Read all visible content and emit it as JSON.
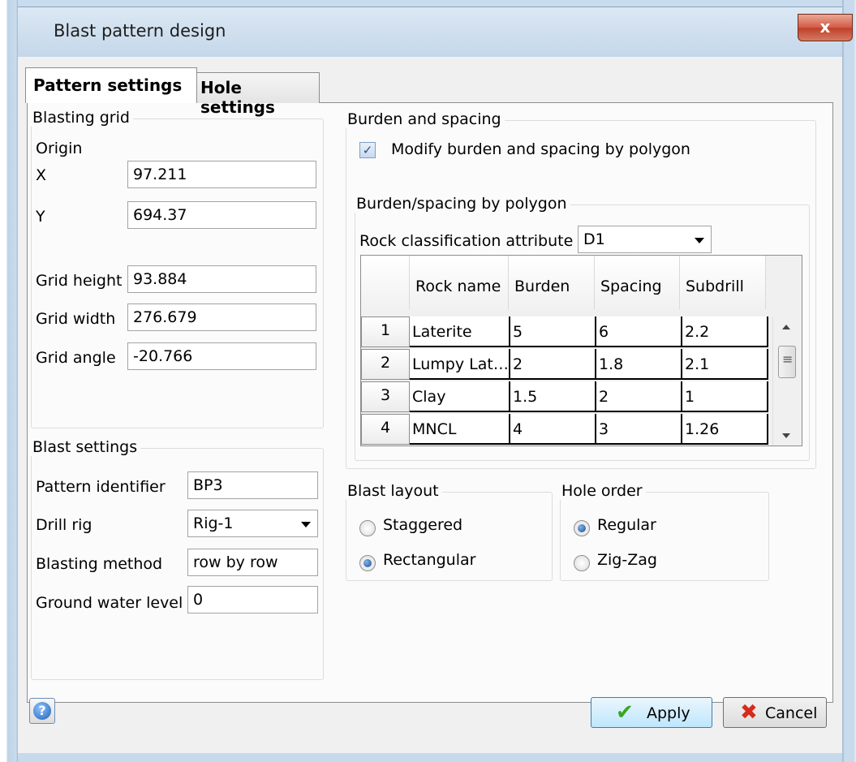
{
  "window": {
    "title": "Blast pattern design",
    "close_glyph": "x"
  },
  "tabs": [
    {
      "label": "Pattern settings",
      "active": true
    },
    {
      "label": "Hole settings",
      "active": false
    }
  ],
  "blasting_grid": {
    "title": "Blasting grid",
    "origin_label": "Origin",
    "x_label": "X",
    "x_value": "97.211",
    "y_label": "Y",
    "y_value": "694.37",
    "grid_height_label": "Grid height",
    "grid_height_value": "93.884",
    "grid_width_label": "Grid width",
    "grid_width_value": "276.679",
    "grid_angle_label": "Grid angle",
    "grid_angle_value": "-20.766"
  },
  "blast_settings": {
    "title": "Blast settings",
    "pattern_identifier_label": "Pattern identifier",
    "pattern_identifier_value": "BP3",
    "drill_rig_label": "Drill rig",
    "drill_rig_value": "Rig-1",
    "blasting_method_label": "Blasting method",
    "blasting_method_value": "row by row",
    "ground_water_label": "Ground water level",
    "ground_water_value": "0"
  },
  "burden_spacing": {
    "title": "Burden and spacing",
    "modify_label": "Modify burden and spacing by polygon",
    "modify_checked": true,
    "polygon_group_title": "Burden/spacing by polygon",
    "rock_attr_label": "Rock classification attribute",
    "rock_attr_value": "D1",
    "columns": [
      "Rock name",
      "Burden",
      "Spacing",
      "Subdrill"
    ],
    "rows": [
      {
        "num": "1",
        "rock": "Laterite",
        "burden": "5",
        "spacing": "6",
        "subdrill": "2.2"
      },
      {
        "num": "2",
        "rock": "Lumpy Lat…",
        "burden": "2",
        "spacing": "1.8",
        "subdrill": "2.1"
      },
      {
        "num": "3",
        "rock": "Clay",
        "burden": "1.5",
        "spacing": "2",
        "subdrill": "1"
      },
      {
        "num": "4",
        "rock": "MNCL",
        "burden": "4",
        "spacing": "3",
        "subdrill": "1.26"
      }
    ]
  },
  "blast_layout": {
    "title": "Blast layout",
    "options": [
      "Staggered",
      "Rectangular"
    ],
    "selected": "Rectangular"
  },
  "hole_order": {
    "title": "Hole order",
    "options": [
      "Regular",
      "Zig-Zag"
    ],
    "selected": "Regular"
  },
  "footer": {
    "help_glyph": "?",
    "apply_label": "Apply",
    "cancel_label": "Cancel"
  }
}
